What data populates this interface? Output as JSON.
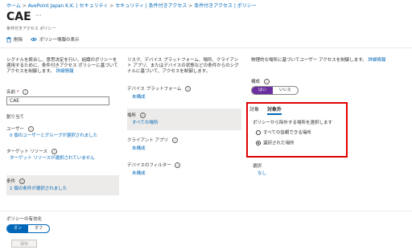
{
  "breadcrumb": {
    "items": [
      "ホーム",
      "AvePoint Japan K.K. | セキュリティ",
      "セキュリティ | 条件付きアクセス",
      "条件付きアクセス | ポリシー"
    ],
    "separator": ">"
  },
  "page": {
    "title": "CAE",
    "more": "···",
    "subtitle": "条件付きアクセス ポリシー"
  },
  "toolbar": {
    "delete_label": "削除",
    "view_info_label": "ポリシー情報の表示"
  },
  "left": {
    "description": "シグナルを統合し、意思決定を行い、組織のポリシーを適用するために、条件付きアクセス ポリシーに基づいてアクセスを制御します。",
    "details_link": "詳細情報",
    "name_label": "名前",
    "name_required": "*",
    "name_value": "CAE",
    "assignments_label": "割り当て",
    "users_label": "ユーザー",
    "users_value": "0 個のユーザーとグループが選択されました",
    "target_label": "ターゲット リソース",
    "target_value": "ターゲット リソースが選択されていません",
    "conditions_label": "条件",
    "conditions_value": "1 個の条件が選択されました"
  },
  "middle": {
    "description": "リスク、デバイス プラットフォーム、場所、クライアント アプリ、またはデバイスの状態などの条件からのシグナルに基づいて、アクセスを制御します。",
    "items": [
      {
        "label": "デバイス プラットフォーム",
        "value": "未構成"
      },
      {
        "label": "場所",
        "value": "すべての場所"
      },
      {
        "label": "クライアント アプリ",
        "value": "未構成"
      },
      {
        "label": "デバイスのフィルター",
        "value": "未構成"
      }
    ]
  },
  "right": {
    "description": "物理的な場所に基づいてユーザー アクセスを制御します。",
    "details_link": "詳細情報",
    "configure_label": "構成",
    "toggle_yes": "はい",
    "toggle_no": "いいえ",
    "tab_include": "対象",
    "tab_exclude": "対象外",
    "exclude_prompt": "ポリシーから除外する場所を選択します",
    "option_all_trusted": "すべての信頼できる場所",
    "option_selected": "選択された場所",
    "select_label": "選択",
    "select_value": "なし"
  },
  "footer": {
    "enable_label": "ポリシーの有効化",
    "toggle_on": "オン",
    "toggle_off": "オフ",
    "save_label": "保存"
  },
  "colors": {
    "link": "#0067b8",
    "toggle_purple": "#6b2fa0",
    "highlight_border": "#e00000"
  }
}
